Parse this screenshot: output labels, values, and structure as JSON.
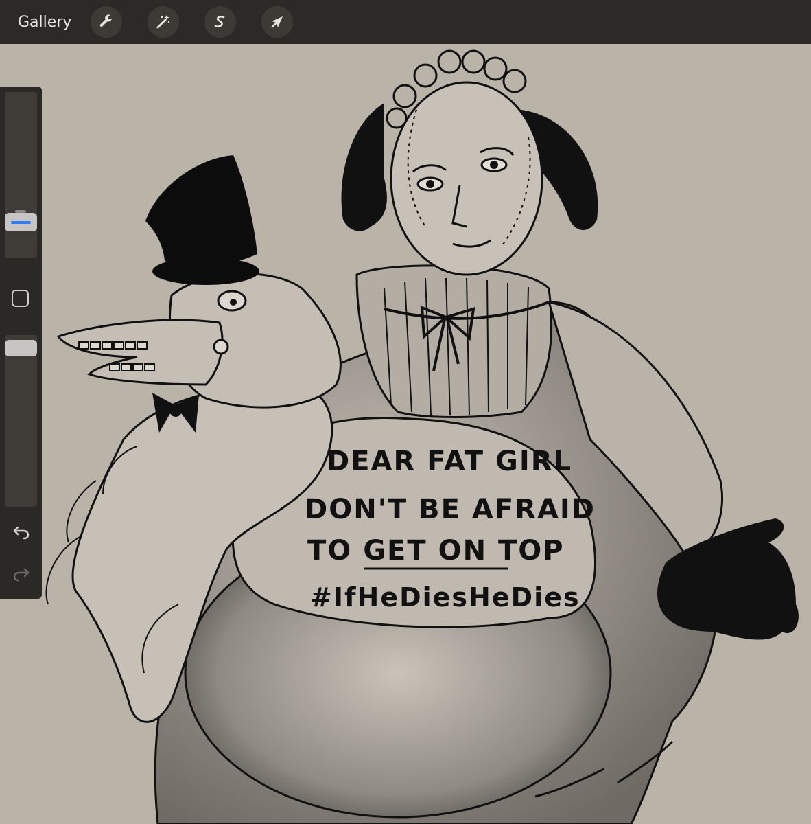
{
  "topbar": {
    "gallery_label": "Gallery",
    "tools": [
      {
        "name": "actions",
        "icon": "wrench-icon"
      },
      {
        "name": "adjustments",
        "icon": "magic-wand-icon"
      },
      {
        "name": "selection",
        "icon": "selection-s-icon"
      },
      {
        "name": "transform",
        "icon": "arrow-cursor-icon"
      }
    ]
  },
  "sidebar": {
    "brush_size_level": 0.18,
    "brush_opacity_level": 0.97
  },
  "artwork": {
    "shirt_lines": [
      "DEAR FAT GIRL",
      "DON'T BE AFRAID",
      "TO GET ON TOP",
      "#IfHeDiesHeDies"
    ]
  },
  "colors": {
    "toolbar": "#2c2a27",
    "canvas": "#bab3a8",
    "accent": "#2f7df6"
  }
}
